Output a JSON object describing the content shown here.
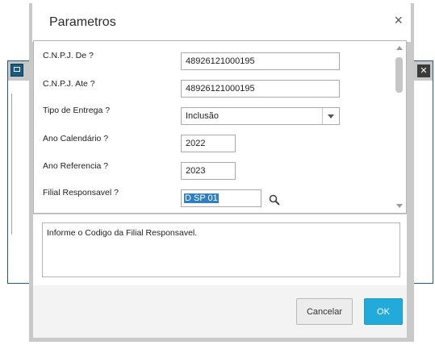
{
  "dialog": {
    "title": "Parametros",
    "close_icon": "×"
  },
  "params": [
    {
      "label": "C.N.P.J. De ?",
      "value": "48926121000195"
    },
    {
      "label": "C.N.P.J. Ate ?",
      "value": "48926121000195"
    },
    {
      "label": "Tipo de Entrega ?",
      "value": "Inclusão",
      "options": [
        "Inclusão"
      ]
    },
    {
      "label": "Ano Calendário ?",
      "value": "2022"
    },
    {
      "label": "Ano Referencia ?",
      "value": "2023"
    },
    {
      "label": "Filial Responsavel ?",
      "value": "D SP 01"
    }
  ],
  "help": {
    "text": "Informe o Codigo da Filial Responsavel."
  },
  "footer": {
    "cancel_label": "Cancelar",
    "ok_label": "OK"
  },
  "icons": {
    "lookup": "search-icon",
    "dropdown": "chevron-down-icon"
  },
  "colors": {
    "ok_button": "#22aadb",
    "selection": "#2f7fc1"
  }
}
